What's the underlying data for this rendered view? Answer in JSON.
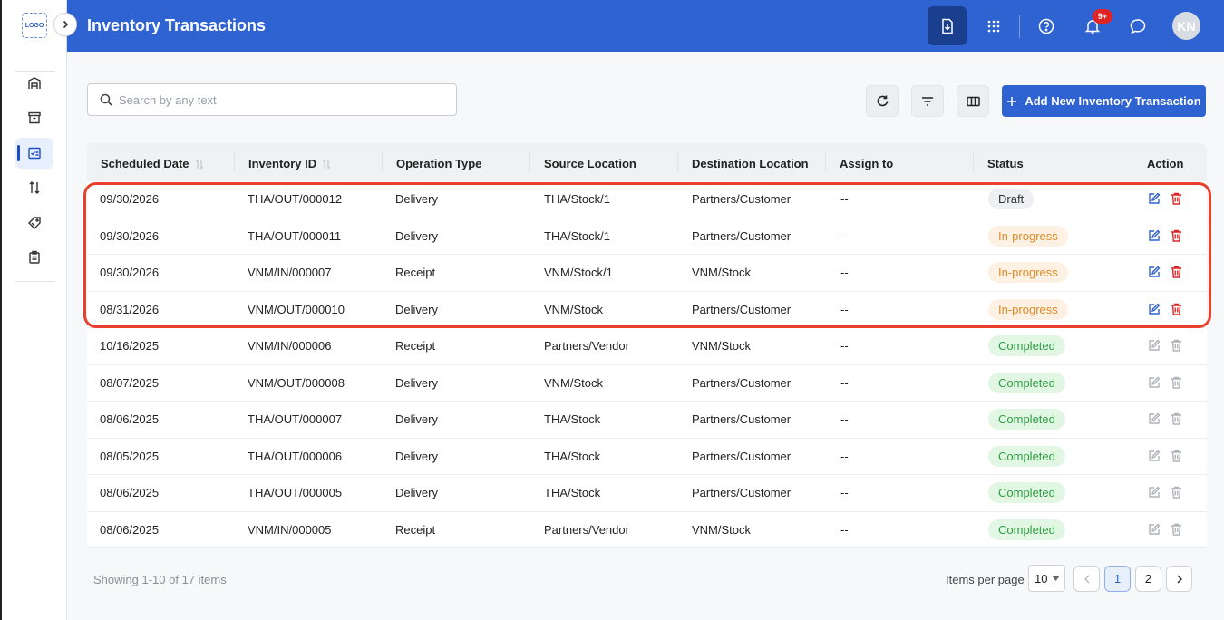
{
  "app": {
    "logo_text": "LOGO",
    "title": "Inventory Transactions"
  },
  "header": {
    "notification_badge": "9+",
    "avatar_initials": "KN",
    "icons": [
      "download-doc-icon",
      "apps-grid-icon",
      "help-icon",
      "bell-icon",
      "chat-icon"
    ]
  },
  "sidebar": {
    "items": [
      {
        "icon": "warehouse-icon",
        "active": false
      },
      {
        "icon": "archive-box-icon",
        "active": false
      },
      {
        "icon": "transactions-icon",
        "active": true
      },
      {
        "icon": "transfer-icon",
        "active": false
      },
      {
        "icon": "tag-icon",
        "active": false
      },
      {
        "icon": "clipboard-icon",
        "active": false
      }
    ]
  },
  "toolbar": {
    "search_placeholder": "Search by any text",
    "add_label": "Add New Inventory Transaction"
  },
  "table": {
    "columns": [
      "Scheduled Date",
      "Inventory ID",
      "Operation Type",
      "Source Location",
      "Destination Location",
      "Assign to",
      "Status",
      "Action"
    ],
    "rows": [
      {
        "date": "09/30/2026",
        "id": "THA/OUT/000012",
        "op": "Delivery",
        "src": "THA/Stock/1",
        "dst": "Partners/Customer",
        "assign": "--",
        "status": "Draft",
        "status_kind": "draft"
      },
      {
        "date": "09/30/2026",
        "id": "THA/OUT/000011",
        "op": "Delivery",
        "src": "THA/Stock/1",
        "dst": "Partners/Customer",
        "assign": "--",
        "status": "In-progress",
        "status_kind": "inprogress"
      },
      {
        "date": "09/30/2026",
        "id": "VNM/IN/000007",
        "op": "Receipt",
        "src": "VNM/Stock/1",
        "dst": "VNM/Stock",
        "assign": "--",
        "status": "In-progress",
        "status_kind": "inprogress"
      },
      {
        "date": "08/31/2026",
        "id": "VNM/OUT/000010",
        "op": "Delivery",
        "src": "VNM/Stock",
        "dst": "Partners/Customer",
        "assign": "--",
        "status": "In-progress",
        "status_kind": "inprogress"
      },
      {
        "date": "10/16/2025",
        "id": "VNM/IN/000006",
        "op": "Receipt",
        "src": "Partners/Vendor",
        "dst": "VNM/Stock",
        "assign": "--",
        "status": "Completed",
        "status_kind": "completed"
      },
      {
        "date": "08/07/2025",
        "id": "VNM/OUT/000008",
        "op": "Delivery",
        "src": "VNM/Stock",
        "dst": "Partners/Customer",
        "assign": "--",
        "status": "Completed",
        "status_kind": "completed"
      },
      {
        "date": "08/06/2025",
        "id": "THA/OUT/000007",
        "op": "Delivery",
        "src": "THA/Stock",
        "dst": "Partners/Customer",
        "assign": "--",
        "status": "Completed",
        "status_kind": "completed"
      },
      {
        "date": "08/05/2025",
        "id": "THA/OUT/000006",
        "op": "Delivery",
        "src": "THA/Stock",
        "dst": "Partners/Customer",
        "assign": "--",
        "status": "Completed",
        "status_kind": "completed"
      },
      {
        "date": "08/06/2025",
        "id": "THA/OUT/000005",
        "op": "Delivery",
        "src": "THA/Stock",
        "dst": "Partners/Customer",
        "assign": "--",
        "status": "Completed",
        "status_kind": "completed"
      },
      {
        "date": "08/06/2025",
        "id": "VNM/IN/000005",
        "op": "Receipt",
        "src": "Partners/Vendor",
        "dst": "VNM/Stock",
        "assign": "--",
        "status": "Completed",
        "status_kind": "completed"
      }
    ]
  },
  "footer": {
    "showing": "Showing 1-10 of 17 items",
    "items_per_page_label": "Items per page",
    "items_per_page_value": "10",
    "pages": [
      "1",
      "2"
    ],
    "current_page": "1"
  },
  "colors": {
    "primary": "#2e63d1",
    "edit_active": "#2e63d1",
    "delete_active": "#e02424",
    "disabled": "#b0b4ba"
  }
}
